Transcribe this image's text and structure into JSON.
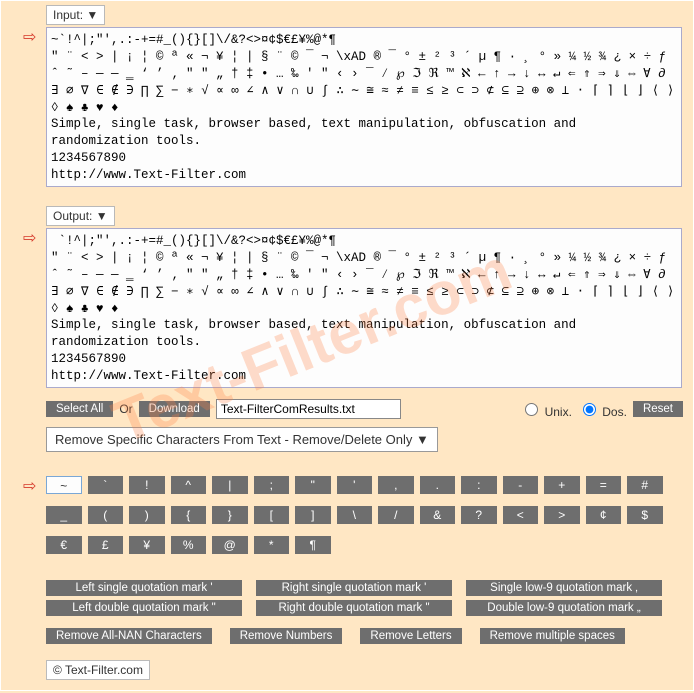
{
  "watermark": "Text-Filter.com",
  "labels": {
    "input": "Input: ▼",
    "output": "Output: ▼"
  },
  "input_text": "~`!^|;\"',.:-+=#_(){}[]\\/&?<>¤¢$€£¥%@*¶\n\" ¨ < > | ¡ ¦ © ª « ¬ ¥ ¦ | § ¨ © ¯ ¬ \\xAD ® ¯ ° ± ² ³ ´ µ ¶ · ¸ ° » ¼ ½ ¾ ¿ × ÷ ƒ ˆ ˜ – — ― ‗ ‘ ’ ‚ \" \" „ † ‡ • … ‰ ′ ″ ‹ › ‾ ⁄ ℘ ℑ ℜ ™ ℵ ← ↑ → ↓ ↔ ↵ ⇐ ⇑ ⇒ ⇓ ⇔ ∀ ∂ ∃ ∅ ∇ ∈ ∉ ∋ ∏ ∑ − ∗ √ ∝ ∞ ∠ ∧ ∨ ∩ ∪ ∫ ∴ ∼ ≅ ≈ ≠ ≡ ≤ ≥ ⊂ ⊃ ⊄ ⊆ ⊇ ⊕ ⊗ ⊥ ⋅ ⌈ ⌉ ⌊ ⌋ ⟨ ⟩ ◊ ♠ ♣ ♥ ♦\nSimple, single task, browser based, text manipulation, obfuscation and randomization tools.\n1234567890\nhttp://www.Text-Filter.com",
  "output_text": " `!^|;\"',.:-+=#_(){}[]\\/&?<>¤¢$€£¥%@*¶\n\" ¨ < > | ¡ ¦ © ª « ¬ ¥ ¦ | § ¨ © ¯ ¬ \\xAD ® ¯ ° ± ² ³ ´ µ ¶ · ¸ ° » ¼ ½ ¾ ¿ × ÷ ƒ ˆ ˜ – — ― ‗ ‘ ’ ‚ \" \" „ † ‡ • … ‰ ′ ″ ‹ › ‾ ⁄ ℘ ℑ ℜ ™ ℵ ← ↑ → ↓ ↔ ↵ ⇐ ⇑ ⇒ ⇓ ⇔ ∀ ∂ ∃ ∅ ∇ ∈ ∉ ∋ ∏ ∑ − ∗ √ ∝ ∞ ∠ ∧ ∨ ∩ ∪ ∫ ∴ ∼ ≅ ≈ ≠ ≡ ≤ ≥ ⊂ ⊃ ⊄ ⊆ ⊇ ⊕ ⊗ ⊥ ⋅ ⌈ ⌉ ⌊ ⌋ ⟨ ⟩ ◊ ♠ ♣ ♥ ♦\nSimple, single task, browser based, text manipulation, obfuscation and randomization tools.\n1234567890\nhttp://www.Text-Filter.com",
  "controls": {
    "select_all": "Select All",
    "or": "Or",
    "download": "Download",
    "filename": "Text-FilterComResults.txt",
    "unix": "Unix.",
    "dos": "Dos.",
    "reset": "Reset",
    "mode": "Remove Specific Characters From Text - Remove/Delete Only ▼"
  },
  "char_buttons_row1": [
    "~",
    "`",
    "!",
    "^",
    "|",
    ";",
    "\"",
    "'",
    ",",
    ".",
    ":",
    "-",
    "+",
    "=",
    "#"
  ],
  "char_buttons_row2": [
    "_",
    "(",
    ")",
    "{",
    "}",
    "[",
    "]",
    "\\",
    "/",
    "&",
    "?",
    "<",
    ">",
    "¢",
    "$"
  ],
  "char_buttons_row3": [
    "€",
    "£",
    "¥",
    "%",
    "@",
    "*",
    "¶"
  ],
  "active_char": "~",
  "quote_buttons": [
    "Left single quotation mark  '",
    "Right single quotation mark  '",
    "Single low-9 quotation mark ‚",
    "Left double quotation mark \"",
    "Right double quotation mark \"",
    "Double low-9 quotation mark „"
  ],
  "action_buttons": [
    "Remove All-NAN Characters",
    "Remove Numbers",
    "Remove Letters",
    "Remove multiple spaces"
  ],
  "footer": "© Text-Filter.com"
}
